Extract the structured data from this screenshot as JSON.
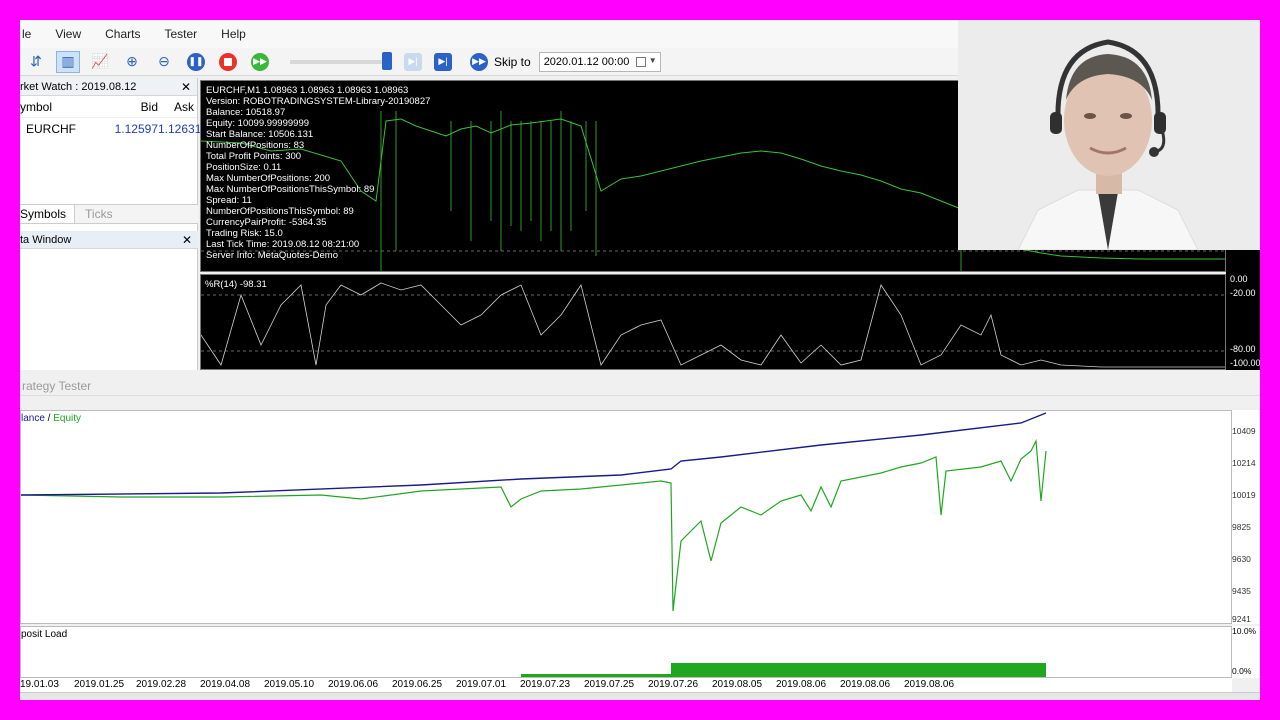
{
  "menu": [
    "le",
    "View",
    "Charts",
    "Tester",
    "Help"
  ],
  "toolbar": {
    "skip_label": "Skip to",
    "skip_date": "2020.01.12 00:00"
  },
  "market_watch": {
    "title": "rket Watch : 2019.08.12",
    "headers": [
      "ymbol",
      "Bid",
      "Ask"
    ],
    "row": {
      "symbol": "EURCHF",
      "bid": "1.12597",
      "ask": "1.12631"
    },
    "tabs": [
      "Symbols",
      "Ticks"
    ]
  },
  "data_window": {
    "title": "ta Window"
  },
  "chart_info": [
    "EURCHF,M1  1.08963 1.08963 1.08963 1.08963",
    "Version: ROBOTRADINGSYSTEM-Library-20190827",
    "Balance: 10518.97",
    "Equity: 10099.99999999",
    "Start Balance: 10506.131",
    "NumberOfPositions: 83",
    "Total Profit Points: 300",
    "PositionSize: 0.11",
    "Max NumberOfPositions: 200",
    "Max NumberOfPositionsThisSymbol: 89",
    "Spread: 11",
    "NumberOfPositionsThisSymbol: 89",
    "CurrencyPairProfit: -5364.35",
    "Trading Risk: 15.0",
    "Last Tick Time: 2019.08.12 08:21:00",
    "Server Info: MetaQuotes-Demo"
  ],
  "oscillator": {
    "label": "%R(14) -98.31",
    "levels": [
      "0.00",
      "-20.00",
      "-80.00",
      "-100.00"
    ]
  },
  "strategy_tester": {
    "title": "rategy Tester"
  },
  "balance_chart": {
    "legend_balance": "lance",
    "legend_sep": " / ",
    "legend_equity": "Equity",
    "axis": [
      "10409",
      "10214",
      "10019",
      "9825",
      "9630",
      "9435",
      "9241"
    ]
  },
  "deposit_load": {
    "label": "posit Load",
    "axis": [
      "10.0%",
      "0.0%"
    ]
  },
  "dates": [
    "19.01.03",
    "2019.01.25",
    "2019.02.28",
    "2019.04.08",
    "2019.05.10",
    "2019.06.06",
    "2019.06.25",
    "2019.07.01",
    "2019.07.23",
    "2019.07.25",
    "2019.07.26",
    "2019.08.05",
    "2019.08.06",
    "2019.08.06",
    "2019.08.06"
  ],
  "colors": {
    "balance": "#1a1a8c",
    "equity": "#1fa81f",
    "chart_line": "#39c239"
  }
}
